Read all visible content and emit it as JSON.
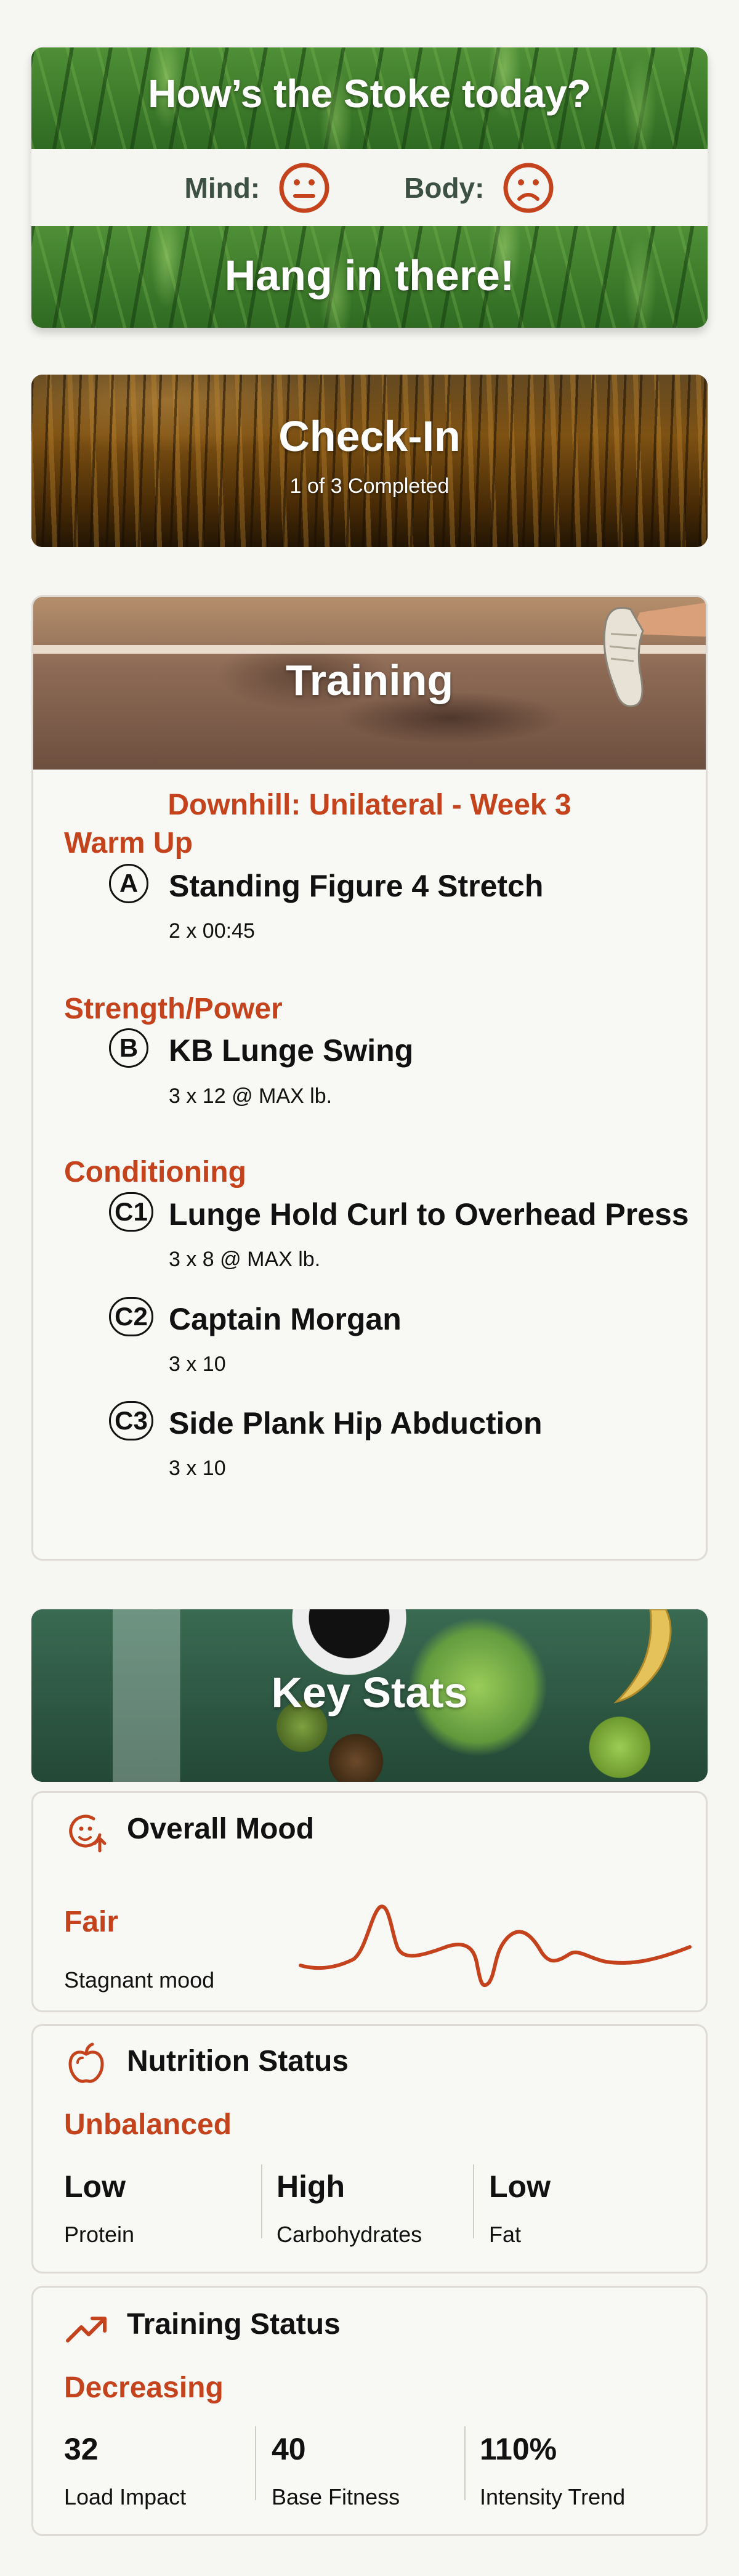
{
  "stoke": {
    "title": "How’s the Stoke today?",
    "mind_label": "Mind:",
    "mind_face": "neutral-face",
    "body_label": "Body:",
    "body_face": "sad-face",
    "message": "Hang in there!"
  },
  "checkin": {
    "title": "Check-In",
    "progress": "1 of 3 Completed"
  },
  "training": {
    "title": "Training",
    "workout": "Downhill: Unilateral - Week 3",
    "sections": [
      {
        "title": "Warm Up",
        "exercises": [
          {
            "marker": "A",
            "name": "Standing Figure 4 Stretch",
            "detail": "2 x 00:45"
          }
        ]
      },
      {
        "title": "Strength/Power",
        "exercises": [
          {
            "marker": "B",
            "name": "KB Lunge Swing",
            "detail": "3 x 12 @ MAX lb."
          }
        ]
      },
      {
        "title": "Conditioning",
        "exercises": [
          {
            "marker": "C1",
            "name": "Lunge Hold Curl to Overhead Press",
            "detail": "3 x 8 @ MAX lb."
          },
          {
            "marker": "C2",
            "name": "Captain Morgan",
            "detail": "3 x 10"
          },
          {
            "marker": "C3",
            "name": "Side Plank Hip Abduction",
            "detail": "3 x 10"
          }
        ]
      }
    ]
  },
  "key_stats": {
    "title": "Key Stats"
  },
  "overall_mood": {
    "icon": "smile-trend-icon",
    "title": "Overall Mood",
    "status": "Fair",
    "caption": "Stagnant mood"
  },
  "nutrition": {
    "icon": "apple-icon",
    "title": "Nutrition Status",
    "status": "Unbalanced",
    "metrics": [
      {
        "value": "Low",
        "label": "Protein"
      },
      {
        "value": "High",
        "label": "Carbohydrates"
      },
      {
        "value": "Low",
        "label": "Fat"
      }
    ]
  },
  "training_status": {
    "icon": "trending-up-icon",
    "title": "Training Status",
    "status": "Decreasing",
    "metrics": [
      {
        "value": "32",
        "label": "Load Impact"
      },
      {
        "value": "40",
        "label": "Base Fitness"
      },
      {
        "value": "110%",
        "label": "Intensity Trend"
      }
    ]
  },
  "colors": {
    "accent": "#c4431c",
    "mood_label": "#3c5044",
    "card_border": "#dedbd6",
    "background": "#f6f6f2"
  }
}
